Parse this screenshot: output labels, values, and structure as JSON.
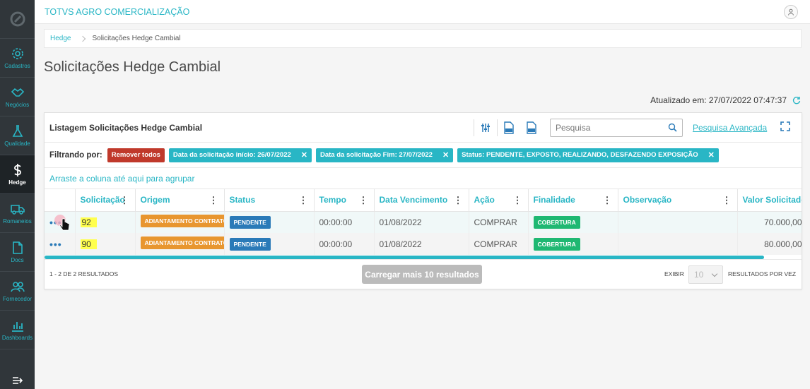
{
  "sidebar": {
    "items": [
      {
        "label": "Cadastros",
        "icon": "gear-icon"
      },
      {
        "label": "Negócios",
        "icon": "handshake-icon"
      },
      {
        "label": "Qualidade",
        "icon": "flask-icon"
      },
      {
        "label": "Hedge",
        "icon": "dollar-icon"
      },
      {
        "label": "Romaneios",
        "icon": "truck-icon"
      },
      {
        "label": "Docs",
        "icon": "document-icon"
      },
      {
        "label": "Fornecedor",
        "icon": "users-icon"
      },
      {
        "label": "Dashboards",
        "icon": "bar-chart-icon"
      }
    ]
  },
  "header": {
    "app_title": "TOTVS AGRO COMERCIALIZAÇÃO"
  },
  "breadcrumb": {
    "root": "Hedge",
    "current": "Solicitações Hedge Cambial"
  },
  "page": {
    "title": "Solicitações Hedge Cambial",
    "updated": "Atualizado em: 27/07/2022 07:47:37"
  },
  "card": {
    "title": "Listagem Solicitações Hedge Cambial",
    "search_placeholder": "Pesquisa",
    "advanced_search": "Pesquisa Avançada"
  },
  "filters": {
    "label": "Filtrando por:",
    "remove_all": "Remover todos",
    "chips": [
      "Data da solicitação início: 26/07/2022",
      "Data da solicitação Fim: 27/07/2022",
      "Status: PENDENTE, EXPOSTO, REALIZANDO, DESFAZENDO EXPOSIÇÃO"
    ]
  },
  "group_hint": "Arraste a coluna até aqui para agrupar",
  "table": {
    "columns": [
      "Solicitação",
      "Origem",
      "Status",
      "Tempo",
      "Data Vencimento",
      "Ação",
      "Finalidade",
      "Observação",
      "Valor Solicitado"
    ],
    "rows": [
      {
        "solicitacao": "92",
        "origem": "ADIANTAMENTO CONTRATO",
        "status": "PENDENTE",
        "tempo": "00:00:00",
        "vencimento": "01/08/2022",
        "acao": "COMPRAR",
        "finalidade": "COBERTURA",
        "observacao": "",
        "valor": "70.000,00"
      },
      {
        "solicitacao": "90",
        "origem": "ADIANTAMENTO CONTRATO",
        "status": "PENDENTE",
        "tempo": "00:00:00",
        "vencimento": "01/08/2022",
        "acao": "COMPRAR",
        "finalidade": "COBERTURA",
        "observacao": "",
        "valor": "80.000,00"
      }
    ]
  },
  "footer": {
    "results": "1 - 2 DE 2 RESULTADOS",
    "load_more": "Carregar mais 10 resultados",
    "exibir": "EXIBIR",
    "per_page": "10",
    "per_page_label": "RESULTADOS POR VEZ"
  },
  "colors": {
    "accent": "#29b6c5",
    "sidebar": "#30363a",
    "danger": "#c0392b",
    "pending": "#2a7ab8",
    "origin": "#e8962f",
    "purpose": "#1fb872"
  }
}
